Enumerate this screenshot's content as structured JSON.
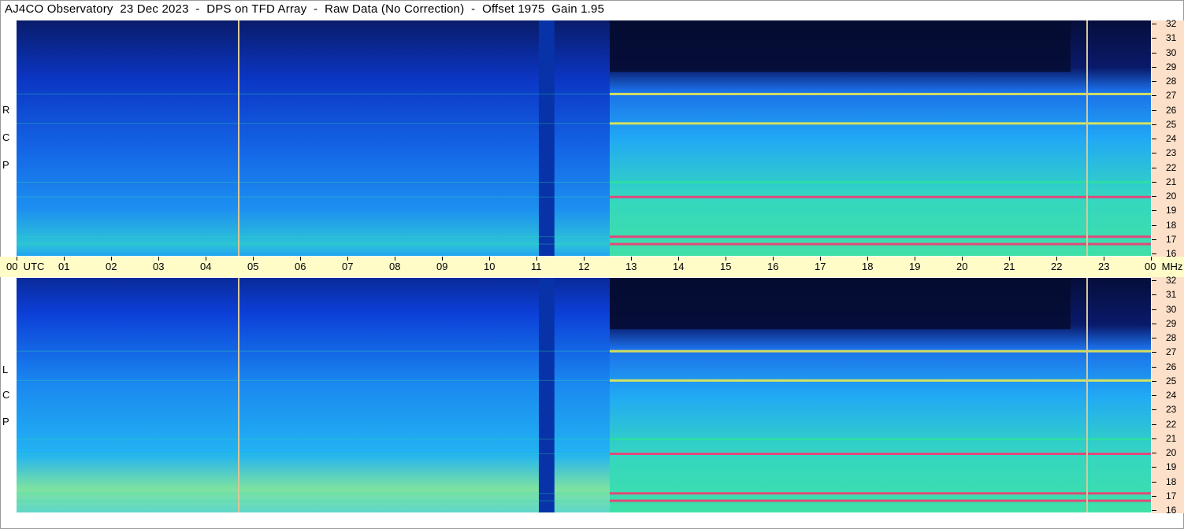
{
  "title": "AJ4CO Observatory  23 Dec 2023  -  DPS on TFD Array  -  Raw Data (No Correction)  -  Offset 1975  Gain 1.95",
  "panels": {
    "rcp_label": [
      "R",
      "C",
      "P"
    ],
    "lcp_label": [
      "L",
      "C",
      "P"
    ]
  },
  "colors": {
    "background_dark": "#0a1a55",
    "band_blue": "#0b3fd8",
    "mid_cyan": "#21a3ff",
    "emission_green": "#2de0a0",
    "emission_yellow": "#f2f04a",
    "emission_red": "#ff3070",
    "marker_line": "#d8c79a",
    "time_axis_bg": "#fffcc8",
    "freq_axis_bg": "#fde0c9"
  },
  "chart_data": {
    "type": "heatmap",
    "x_axis": {
      "unit": "UTC",
      "range": [
        0,
        24
      ],
      "tick_labels": [
        "00  UTC",
        "01",
        "02",
        "03",
        "04",
        "05",
        "06",
        "07",
        "08",
        "09",
        "10",
        "11",
        "12",
        "13",
        "14",
        "15",
        "16",
        "17",
        "18",
        "19",
        "20",
        "21",
        "22",
        "23",
        "00  MHz"
      ]
    },
    "y_axis": {
      "unit": "MHz",
      "range": [
        16,
        32
      ],
      "tick_labels": [
        "32",
        "31",
        "30",
        "29",
        "28",
        "27",
        "26",
        "25",
        "24",
        "23",
        "22",
        "21",
        "20",
        "19",
        "18",
        "17",
        "16"
      ]
    },
    "series": [
      {
        "name": "RCP"
      },
      {
        "name": "LCP"
      }
    ],
    "vertical_markers_utc": [
      4.7,
      22.65
    ],
    "data_gap_utc": [
      11.05,
      11.38
    ],
    "high_activity_utc": [
      12.55,
      24
    ],
    "persistent_emission_mhz": [
      27.0,
      25.0,
      21.0,
      20.0,
      17.3,
      16.8
    ],
    "dark_regions": [
      {
        "from_utc": 12.55,
        "to_utc": 22.3,
        "above_mhz": 28.5
      }
    ]
  }
}
